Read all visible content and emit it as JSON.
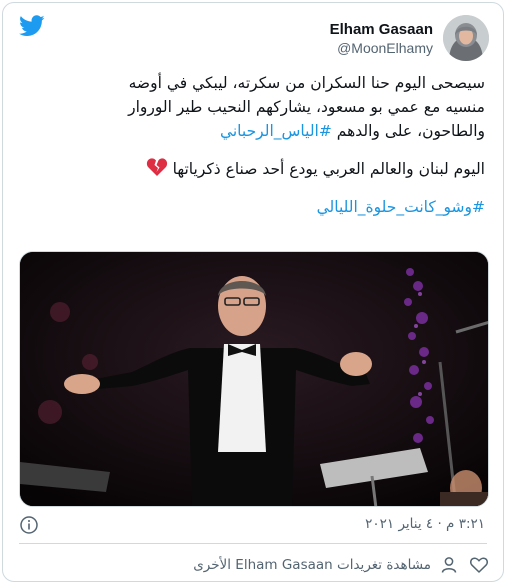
{
  "colors": {
    "twitter_blue": "#1d9bf0",
    "hashtag": "#1b95e0",
    "text": "#0f1419",
    "secondary": "#536471",
    "heart_red": "#e0245e"
  },
  "header": {
    "logo_icon": "twitter-bird-icon",
    "author_name": "Elham Gasaan",
    "author_handle": "@MoonElhamy"
  },
  "tweet": {
    "line1": "سيصحى اليوم حنا السكران من سكرته، ليبكي في أوضه",
    "line2": "منسيه مع عمي بو مسعود، يشاركهم النحيب طير الوروار",
    "line3_text": "والطاحون، على والدهم ",
    "line3_hashtag": "#الياس_الرحباني",
    "line4_text": "اليوم لبنان والعالم العربي يودع أحد صناع ذكرياتها",
    "line4_emoji": "broken-heart-icon",
    "hashtag2": "#وشو_كانت_حلوة_الليالي"
  },
  "meta": {
    "timestamp": "٣:٢١ م · ٤ يناير ٢٠٢١",
    "info_icon": "info-icon"
  },
  "actions": {
    "like_icon": "heart-icon",
    "view_label": "مشاهدة تغريدات Elham Gasaan الأخرى",
    "person_icon": "person-icon"
  }
}
